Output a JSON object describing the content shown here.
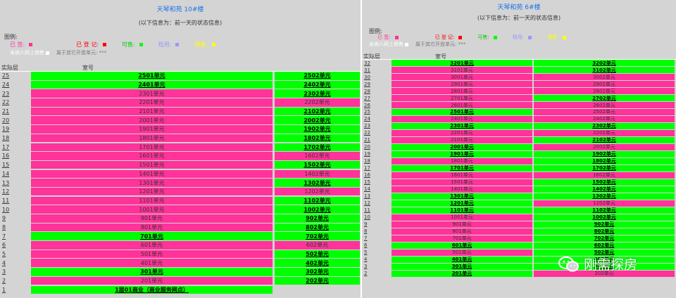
{
  "colors": {
    "sold": "#00ff00",
    "registered": "#ff3399",
    "available": "#00ff00",
    "rent": "#9999ff",
    "reserved": "#ffff00"
  },
  "left": {
    "title": "天琴和苑  10#楼",
    "subtitle": "(以下信息为：前一天的状态信息)",
    "legend_heading": "图例:",
    "legend": [
      {
        "label": "已  签:",
        "color": "#ff3399"
      },
      {
        "label": "已  登  记:",
        "color": "#ff0000"
      },
      {
        "label": "可售:",
        "color": "#00ff00"
      },
      {
        "label": "租用:",
        "color": "#9999ff"
      },
      {
        "label": "预售:",
        "color": "#ffff00"
      }
    ],
    "legend_note_white": "未纳入网上销售",
    "legend_note_gray": "属于其它开盘单元: ***",
    "col_floor": "实际层",
    "col_room": "室号",
    "rows": [
      {
        "floor": "25",
        "a": "2501单元",
        "as": "g",
        "b": "2502单元",
        "bs": "g"
      },
      {
        "floor": "24",
        "a": "2401单元",
        "as": "g",
        "b": "2402单元",
        "bs": "g"
      },
      {
        "floor": "23",
        "a": "2301单元",
        "as": "p",
        "b": "2302单元",
        "bs": "g"
      },
      {
        "floor": "22",
        "a": "2201单元",
        "as": "p",
        "b": "2202单元",
        "bs": "p"
      },
      {
        "floor": "21",
        "a": "2101单元",
        "as": "p",
        "b": "2102单元",
        "bs": "g"
      },
      {
        "floor": "20",
        "a": "2001单元",
        "as": "p",
        "b": "2002单元",
        "bs": "g"
      },
      {
        "floor": "19",
        "a": "1901单元",
        "as": "p",
        "b": "1902单元",
        "bs": "g"
      },
      {
        "floor": "18",
        "a": "1801单元",
        "as": "p",
        "b": "1802单元",
        "bs": "g"
      },
      {
        "floor": "17",
        "a": "1701单元",
        "as": "p",
        "b": "1702单元",
        "bs": "g"
      },
      {
        "floor": "16",
        "a": "1601单元",
        "as": "p",
        "b": "1602单元",
        "bs": "p"
      },
      {
        "floor": "15",
        "a": "1501单元",
        "as": "p",
        "b": "1502单元",
        "bs": "g"
      },
      {
        "floor": "14",
        "a": "1401单元",
        "as": "p",
        "b": "1402单元",
        "bs": "p"
      },
      {
        "floor": "13",
        "a": "1301单元",
        "as": "p",
        "b": "1302单元",
        "bs": "g"
      },
      {
        "floor": "12",
        "a": "1201单元",
        "as": "p",
        "b": "1202单元",
        "bs": "p"
      },
      {
        "floor": "11",
        "a": "1101单元",
        "as": "p",
        "b": "1102单元",
        "bs": "g"
      },
      {
        "floor": "10",
        "a": "1001单元",
        "as": "p",
        "b": "1002单元",
        "bs": "g"
      },
      {
        "floor": "9",
        "a": "901单元",
        "as": "p",
        "b": "902单元",
        "bs": "g"
      },
      {
        "floor": "8",
        "a": "801单元",
        "as": "p",
        "b": "802单元",
        "bs": "g"
      },
      {
        "floor": "7",
        "a": "701单元",
        "as": "g",
        "b": "702单元",
        "bs": "g"
      },
      {
        "floor": "6",
        "a": "601单元",
        "as": "p",
        "b": "602单元",
        "bs": "p"
      },
      {
        "floor": "5",
        "a": "501单元",
        "as": "p",
        "b": "502单元",
        "bs": "g"
      },
      {
        "floor": "4",
        "a": "401单元",
        "as": "p",
        "b": "402单元",
        "bs": "g"
      },
      {
        "floor": "3",
        "a": "301单元",
        "as": "g",
        "b": "302单元",
        "bs": "g"
      },
      {
        "floor": "2",
        "a": "201单元",
        "as": "p",
        "b": "202单元",
        "bs": "g"
      },
      {
        "floor": "1",
        "a": "1层01商业（商业服务网点）",
        "as": "g",
        "b": "",
        "bs": "e"
      }
    ]
  },
  "right": {
    "title": "天琴和苑  6#楼",
    "subtitle": "(以下信息为：前一天的状态信息)",
    "legend_heading": "图例:",
    "legend": [
      {
        "label": "已  签:",
        "color": "#ff3399"
      },
      {
        "label": "已  登  记:",
        "color": "#ff0000"
      },
      {
        "label": "可售:",
        "color": "#00ff00"
      },
      {
        "label": "租用:",
        "color": "#9999ff"
      },
      {
        "label": "预售:",
        "color": "#ffff00"
      }
    ],
    "legend_note_white": "未纳入网上销售",
    "legend_note_gray": "属于其它开盘单元: ***",
    "col_floor": "实际层",
    "col_room": "室号",
    "rows": [
      {
        "floor": "32",
        "a": "3201单元",
        "as": "g",
        "b": "3202单元",
        "bs": "g"
      },
      {
        "floor": "31",
        "a": "3101单元",
        "as": "p",
        "b": "3102单元",
        "bs": "g"
      },
      {
        "floor": "30",
        "a": "3001单元",
        "as": "p",
        "b": "3002单元",
        "bs": "p"
      },
      {
        "floor": "29",
        "a": "2901单元",
        "as": "p",
        "b": "2902单元",
        "bs": "p"
      },
      {
        "floor": "28",
        "a": "2801单元",
        "as": "p",
        "b": "2802单元",
        "bs": "p"
      },
      {
        "floor": "27",
        "a": "2701单元",
        "as": "p",
        "b": "2702单元",
        "bs": "g"
      },
      {
        "floor": "26",
        "a": "2601单元",
        "as": "p",
        "b": "2602单元",
        "bs": "p"
      },
      {
        "floor": "25",
        "a": "2501单元",
        "as": "g",
        "b": "2502单元",
        "bs": "p"
      },
      {
        "floor": "24",
        "a": "2401单元",
        "as": "p",
        "b": "2402单元",
        "bs": "p"
      },
      {
        "floor": "23",
        "a": "2301单元",
        "as": "g",
        "b": "2302单元",
        "bs": "g"
      },
      {
        "floor": "22",
        "a": "2201单元",
        "as": "p",
        "b": "2202单元",
        "bs": "p"
      },
      {
        "floor": "21",
        "a": "2101单元",
        "as": "p",
        "b": "2102单元",
        "bs": "g"
      },
      {
        "floor": "20",
        "a": "2001单元",
        "as": "g",
        "b": "2002单元",
        "bs": "p"
      },
      {
        "floor": "19",
        "a": "1901单元",
        "as": "g",
        "b": "1902单元",
        "bs": "g"
      },
      {
        "floor": "18",
        "a": "1801单元",
        "as": "p",
        "b": "1802单元",
        "bs": "g"
      },
      {
        "floor": "17",
        "a": "1701单元",
        "as": "g",
        "b": "1702单元",
        "bs": "g"
      },
      {
        "floor": "16",
        "a": "1601单元",
        "as": "p",
        "b": "1602单元",
        "bs": "p"
      },
      {
        "floor": "15",
        "a": "1501单元",
        "as": "p",
        "b": "1502单元",
        "bs": "g"
      },
      {
        "floor": "14",
        "a": "1401单元",
        "as": "p",
        "b": "1402单元",
        "bs": "g"
      },
      {
        "floor": "13",
        "a": "1301单元",
        "as": "g",
        "b": "1302单元",
        "bs": "g"
      },
      {
        "floor": "12",
        "a": "1201单元",
        "as": "g",
        "b": "1202单元",
        "bs": "p"
      },
      {
        "floor": "11",
        "a": "1101单元",
        "as": "g",
        "b": "1102单元",
        "bs": "g"
      },
      {
        "floor": "10",
        "a": "1001单元",
        "as": "p",
        "b": "1002单元",
        "bs": "g"
      },
      {
        "floor": "9",
        "a": "901单元",
        "as": "p",
        "b": "902单元",
        "bs": "g"
      },
      {
        "floor": "8",
        "a": "801单元",
        "as": "p",
        "b": "802单元",
        "bs": "g"
      },
      {
        "floor": "7",
        "a": "701单元",
        "as": "p",
        "b": "702单元",
        "bs": "g"
      },
      {
        "floor": "6",
        "a": "601单元",
        "as": "g",
        "b": "602单元",
        "bs": "g"
      },
      {
        "floor": "5",
        "a": "501单元",
        "as": "p",
        "b": "502单元",
        "bs": "g"
      },
      {
        "floor": "4",
        "a": "401单元",
        "as": "g",
        "b": "402单元",
        "bs": "g"
      },
      {
        "floor": "3",
        "a": "301单元",
        "as": "g",
        "b": "302单元",
        "bs": "g"
      },
      {
        "floor": "2",
        "a": "201单元",
        "as": "g",
        "b": "202单元",
        "bs": "p"
      }
    ]
  },
  "watermark": {
    "text": "刚需探房",
    "icon": "wechat-icon"
  }
}
